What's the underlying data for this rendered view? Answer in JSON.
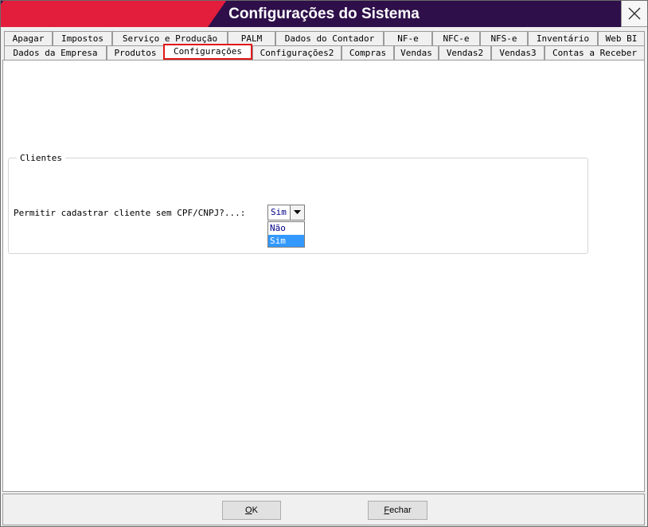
{
  "window": {
    "title": "Configurações do Sistema"
  },
  "tabs": {
    "row1": [
      "Apagar",
      "Impostos",
      "Serviço e Produção",
      "PALM",
      "Dados do Contador",
      "NF-e",
      "NFC-e",
      "NFS-e",
      "Inventário",
      "Web BI"
    ],
    "row2": [
      "Dados da Empresa",
      "Produtos",
      "Configurações",
      "Configurações2",
      "Compras",
      "Vendas",
      "Vendas2",
      "Vendas3",
      "Contas a Receber"
    ],
    "active": "Configurações"
  },
  "group": {
    "legend": "Clientes",
    "field_label": "Permitir cadastrar cliente sem CPF/CNPJ?...:",
    "combo_value": "Sim",
    "options": [
      "Não",
      "Sim"
    ],
    "selected_option": "Sim"
  },
  "buttons": {
    "ok_first": "O",
    "ok_rest": "K",
    "fechar_first": "F",
    "fechar_rest": "echar"
  },
  "colors": {
    "title_bg": "#2e0f4a",
    "title_accent": "#e31d3c",
    "active_tab_border": "#e01818",
    "highlight": "#3399ff"
  },
  "icons": {
    "close": "close-icon",
    "dropdown": "chevron-down-icon"
  }
}
